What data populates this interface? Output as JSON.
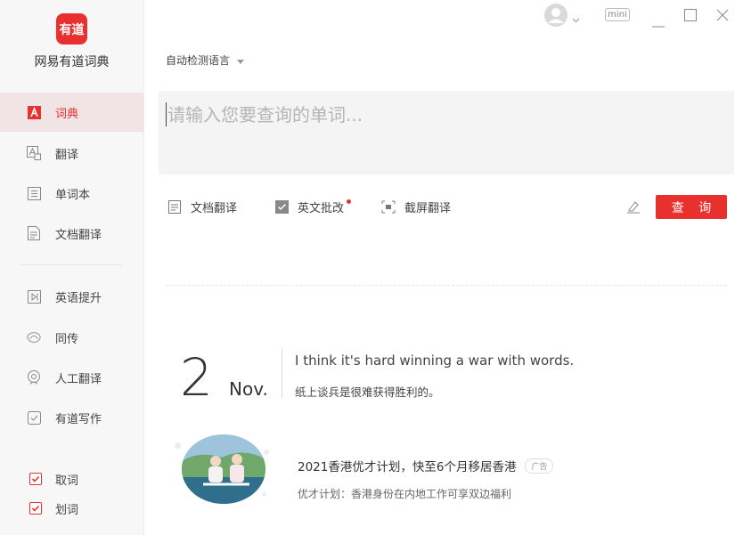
{
  "app": {
    "logo_text": "有道",
    "name": "网易有道词典"
  },
  "sidebar": {
    "items": [
      {
        "label": "词典",
        "icon": "dict-icon",
        "active": true
      },
      {
        "label": "翻译",
        "icon": "translate-icon"
      },
      {
        "label": "单词本",
        "icon": "wordbook-icon"
      },
      {
        "label": "文档翻译",
        "icon": "doc-translate-icon"
      },
      {
        "label": "英语提升",
        "icon": "english-course-icon"
      },
      {
        "label": "同传",
        "icon": "simultaneous-icon"
      },
      {
        "label": "人工翻译",
        "icon": "human-translate-icon"
      },
      {
        "label": "有道写作",
        "icon": "writing-icon"
      }
    ],
    "toggles": [
      {
        "label": "取词",
        "checked": true
      },
      {
        "label": "划词",
        "checked": true
      }
    ]
  },
  "window": {
    "mini_label": "mini"
  },
  "search": {
    "language_label": "自动检测语言",
    "placeholder": "请输入您要查询的单词...",
    "value": ""
  },
  "toolbar": {
    "doc_translate": "文档翻译",
    "english_correction": "英文批改",
    "screenshot_translate": "截屏翻译",
    "query_button": "查 询"
  },
  "daily": {
    "day": "2",
    "month": "Nov.",
    "quote_en": "I think it's hard winning a war with words.",
    "quote_zh": "纸上谈兵是很难获得胜利的。"
  },
  "ad": {
    "title": "2021香港优才计划，快至6个月移居香港",
    "badge": "广告",
    "description": "优才计划：香港身份在内地工作可享双边福利"
  },
  "colors": {
    "accent": "#e8302e",
    "sidebar_bg": "#f7f7f7",
    "search_bg": "#f4f4f4"
  }
}
